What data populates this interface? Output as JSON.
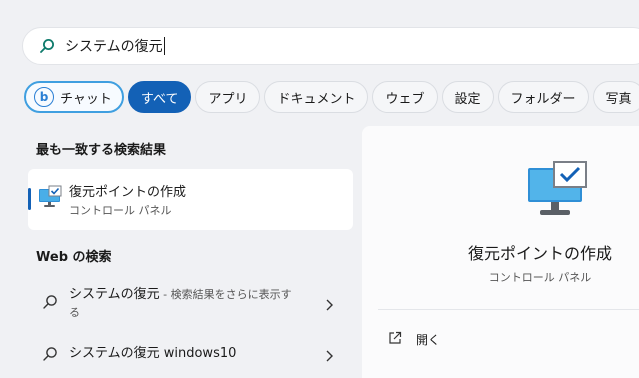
{
  "search": {
    "value": "システムの復元",
    "placeholder": ""
  },
  "tabs": [
    {
      "label": "チャット",
      "icon": "bing-icon"
    },
    {
      "label": "すべて",
      "active": true
    },
    {
      "label": "アプリ"
    },
    {
      "label": "ドキュメント"
    },
    {
      "label": "ウェブ"
    },
    {
      "label": "設定"
    },
    {
      "label": "フォルダー"
    },
    {
      "label": "写真"
    }
  ],
  "best_match": {
    "heading": "最も一致する検索結果",
    "name": "復元ポイントの作成",
    "subtitle": "コントロール パネル",
    "icon": "control-panel-monitor-icon"
  },
  "web": {
    "heading": "Web の検索",
    "results": [
      {
        "query": "システムの復元",
        "hint": " - 検索結果をさらに表示す",
        "hint_wrap": "る"
      },
      {
        "query": "システムの復元 windows10",
        "hint": "",
        "hint_wrap": ""
      }
    ]
  },
  "detail": {
    "name": "復元ポイントの作成",
    "subtitle": "コントロール パネル",
    "open_label": "開く"
  },
  "colors": {
    "accent": "#1361b6",
    "chat_border": "#3f9fe0",
    "background": "#f0f1f4"
  }
}
